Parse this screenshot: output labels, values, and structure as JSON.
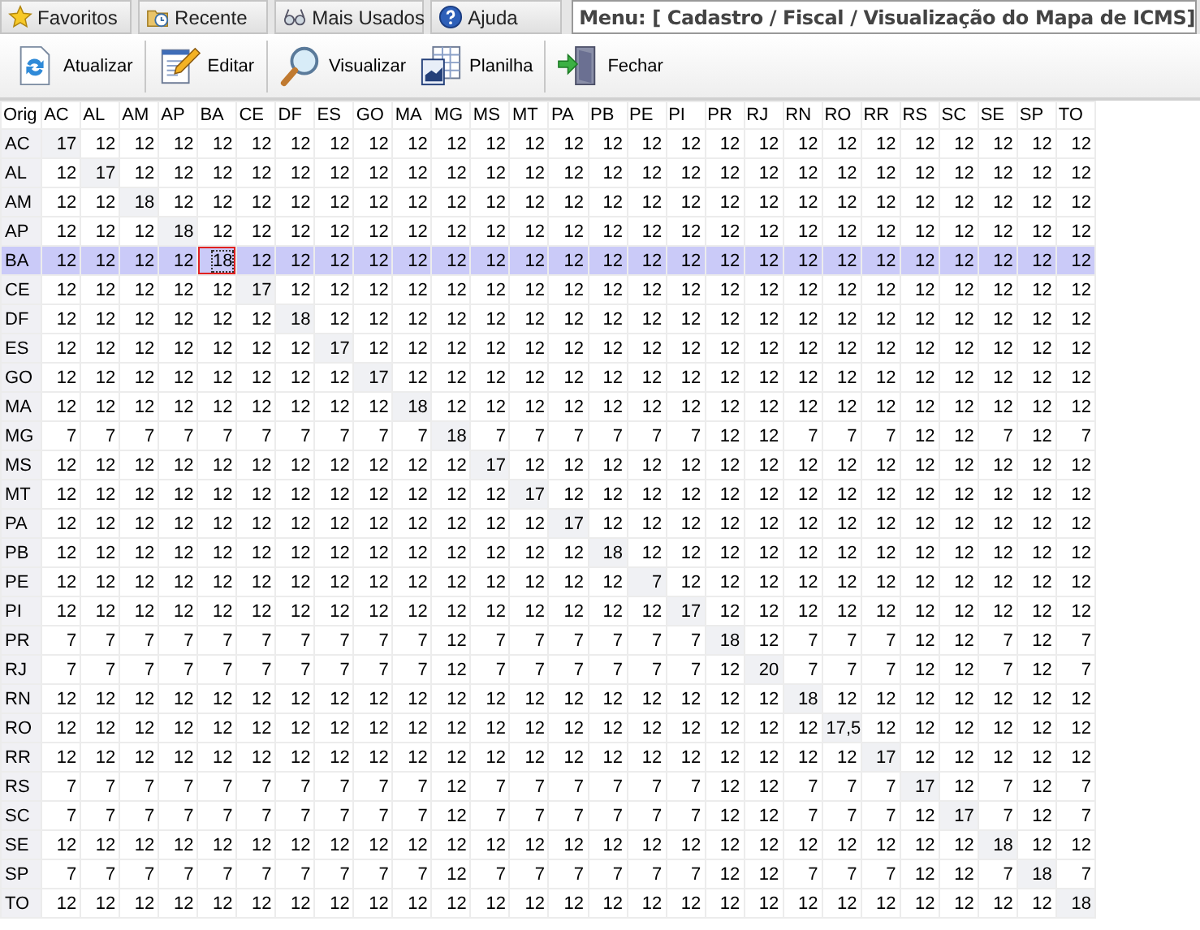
{
  "nav_tabs": [
    {
      "label": "Favoritos"
    },
    {
      "label": "Recente"
    },
    {
      "label": "Mais Usados"
    },
    {
      "label": "Ajuda"
    }
  ],
  "menu_path": "Menu: [ Cadastro / Fiscal / Visualização do Mapa de ICMS]",
  "toolbar": [
    {
      "label": "Atualizar",
      "separator_after": true
    },
    {
      "label": "Editar",
      "separator_after": true
    },
    {
      "label": "Visualizar",
      "separator_after": false
    },
    {
      "label": "Planilha",
      "separator_after": true
    },
    {
      "label": "Fechar",
      "separator_after": false
    }
  ],
  "table": {
    "corner": "Orig",
    "columns": [
      "AC",
      "AL",
      "AM",
      "AP",
      "BA",
      "CE",
      "DF",
      "ES",
      "GO",
      "MA",
      "MG",
      "MS",
      "MT",
      "PA",
      "PB",
      "PE",
      "PI",
      "PR",
      "RJ",
      "RN",
      "RO",
      "RR",
      "RS",
      "SC",
      "SE",
      "SP",
      "TO"
    ],
    "rows": [
      {
        "state": "AC",
        "selected": false,
        "cells": [
          "17",
          "12",
          "12",
          "12",
          "12",
          "12",
          "12",
          "12",
          "12",
          "12",
          "12",
          "12",
          "12",
          "12",
          "12",
          "12",
          "12",
          "12",
          "12",
          "12",
          "12",
          "12",
          "12",
          "12",
          "12",
          "12",
          "12"
        ]
      },
      {
        "state": "AL",
        "selected": false,
        "cells": [
          "12",
          "17",
          "12",
          "12",
          "12",
          "12",
          "12",
          "12",
          "12",
          "12",
          "12",
          "12",
          "12",
          "12",
          "12",
          "12",
          "12",
          "12",
          "12",
          "12",
          "12",
          "12",
          "12",
          "12",
          "12",
          "12",
          "12"
        ]
      },
      {
        "state": "AM",
        "selected": false,
        "cells": [
          "12",
          "12",
          "18",
          "12",
          "12",
          "12",
          "12",
          "12",
          "12",
          "12",
          "12",
          "12",
          "12",
          "12",
          "12",
          "12",
          "12",
          "12",
          "12",
          "12",
          "12",
          "12",
          "12",
          "12",
          "12",
          "12",
          "12"
        ]
      },
      {
        "state": "AP",
        "selected": false,
        "cells": [
          "12",
          "12",
          "12",
          "18",
          "12",
          "12",
          "12",
          "12",
          "12",
          "12",
          "12",
          "12",
          "12",
          "12",
          "12",
          "12",
          "12",
          "12",
          "12",
          "12",
          "12",
          "12",
          "12",
          "12",
          "12",
          "12",
          "12"
        ]
      },
      {
        "state": "BA",
        "selected": true,
        "cells": [
          "12",
          "12",
          "12",
          "12",
          {
            "value": "18",
            "focused": true
          },
          "12",
          "12",
          "12",
          "12",
          "12",
          "12",
          "12",
          "12",
          "12",
          "12",
          "12",
          "12",
          "12",
          "12",
          "12",
          "12",
          "12",
          "12",
          "12",
          "12",
          "12",
          "12"
        ]
      },
      {
        "state": "CE",
        "selected": false,
        "cells": [
          "12",
          "12",
          "12",
          "12",
          "12",
          "17",
          "12",
          "12",
          "12",
          "12",
          "12",
          "12",
          "12",
          "12",
          "12",
          "12",
          "12",
          "12",
          "12",
          "12",
          "12",
          "12",
          "12",
          "12",
          "12",
          "12",
          "12"
        ]
      },
      {
        "state": "DF",
        "selected": false,
        "cells": [
          "12",
          "12",
          "12",
          "12",
          "12",
          "12",
          "18",
          "12",
          "12",
          "12",
          "12",
          "12",
          "12",
          "12",
          "12",
          "12",
          "12",
          "12",
          "12",
          "12",
          "12",
          "12",
          "12",
          "12",
          "12",
          "12",
          "12"
        ]
      },
      {
        "state": "ES",
        "selected": false,
        "cells": [
          "12",
          "12",
          "12",
          "12",
          "12",
          "12",
          "12",
          "17",
          "12",
          "12",
          "12",
          "12",
          "12",
          "12",
          "12",
          "12",
          "12",
          "12",
          "12",
          "12",
          "12",
          "12",
          "12",
          "12",
          "12",
          "12",
          "12"
        ]
      },
      {
        "state": "GO",
        "selected": false,
        "cells": [
          "12",
          "12",
          "12",
          "12",
          "12",
          "12",
          "12",
          "12",
          "17",
          "12",
          "12",
          "12",
          "12",
          "12",
          "12",
          "12",
          "12",
          "12",
          "12",
          "12",
          "12",
          "12",
          "12",
          "12",
          "12",
          "12",
          "12"
        ]
      },
      {
        "state": "MA",
        "selected": false,
        "cells": [
          "12",
          "12",
          "12",
          "12",
          "12",
          "12",
          "12",
          "12",
          "12",
          "18",
          "12",
          "12",
          "12",
          "12",
          "12",
          "12",
          "12",
          "12",
          "12",
          "12",
          "12",
          "12",
          "12",
          "12",
          "12",
          "12",
          "12"
        ]
      },
      {
        "state": "MG",
        "selected": false,
        "cells": [
          "7",
          "7",
          "7",
          "7",
          "7",
          "7",
          "7",
          "7",
          "7",
          "7",
          "18",
          "7",
          "7",
          "7",
          "7",
          "7",
          "7",
          "12",
          "12",
          "7",
          "7",
          "7",
          "12",
          "12",
          "7",
          "12",
          "7"
        ]
      },
      {
        "state": "MS",
        "selected": false,
        "cells": [
          "12",
          "12",
          "12",
          "12",
          "12",
          "12",
          "12",
          "12",
          "12",
          "12",
          "12",
          "17",
          "12",
          "12",
          "12",
          "12",
          "12",
          "12",
          "12",
          "12",
          "12",
          "12",
          "12",
          "12",
          "12",
          "12",
          "12"
        ]
      },
      {
        "state": "MT",
        "selected": false,
        "cells": [
          "12",
          "12",
          "12",
          "12",
          "12",
          "12",
          "12",
          "12",
          "12",
          "12",
          "12",
          "12",
          "17",
          "12",
          "12",
          "12",
          "12",
          "12",
          "12",
          "12",
          "12",
          "12",
          "12",
          "12",
          "12",
          "12",
          "12"
        ]
      },
      {
        "state": "PA",
        "selected": false,
        "cells": [
          "12",
          "12",
          "12",
          "12",
          "12",
          "12",
          "12",
          "12",
          "12",
          "12",
          "12",
          "12",
          "12",
          "17",
          "12",
          "12",
          "12",
          "12",
          "12",
          "12",
          "12",
          "12",
          "12",
          "12",
          "12",
          "12",
          "12"
        ]
      },
      {
        "state": "PB",
        "selected": false,
        "cells": [
          "12",
          "12",
          "12",
          "12",
          "12",
          "12",
          "12",
          "12",
          "12",
          "12",
          "12",
          "12",
          "12",
          "12",
          "18",
          "12",
          "12",
          "12",
          "12",
          "12",
          "12",
          "12",
          "12",
          "12",
          "12",
          "12",
          "12"
        ]
      },
      {
        "state": "PE",
        "selected": false,
        "cells": [
          "12",
          "12",
          "12",
          "12",
          "12",
          "12",
          "12",
          "12",
          "12",
          "12",
          "12",
          "12",
          "12",
          "12",
          "12",
          "7",
          "12",
          "12",
          "12",
          "12",
          "12",
          "12",
          "12",
          "12",
          "12",
          "12",
          "12"
        ]
      },
      {
        "state": "PI",
        "selected": false,
        "cells": [
          "12",
          "12",
          "12",
          "12",
          "12",
          "12",
          "12",
          "12",
          "12",
          "12",
          "12",
          "12",
          "12",
          "12",
          "12",
          "12",
          "17",
          "12",
          "12",
          "12",
          "12",
          "12",
          "12",
          "12",
          "12",
          "12",
          "12"
        ]
      },
      {
        "state": "PR",
        "selected": false,
        "cells": [
          "7",
          "7",
          "7",
          "7",
          "7",
          "7",
          "7",
          "7",
          "7",
          "7",
          "12",
          "7",
          "7",
          "7",
          "7",
          "7",
          "7",
          "18",
          "12",
          "7",
          "7",
          "7",
          "12",
          "12",
          "7",
          "12",
          "7"
        ]
      },
      {
        "state": "RJ",
        "selected": false,
        "cells": [
          "7",
          "7",
          "7",
          "7",
          "7",
          "7",
          "7",
          "7",
          "7",
          "7",
          "12",
          "7",
          "7",
          "7",
          "7",
          "7",
          "7",
          "12",
          "20",
          "7",
          "7",
          "7",
          "12",
          "12",
          "7",
          "12",
          "7"
        ]
      },
      {
        "state": "RN",
        "selected": false,
        "cells": [
          "12",
          "12",
          "12",
          "12",
          "12",
          "12",
          "12",
          "12",
          "12",
          "12",
          "12",
          "12",
          "12",
          "12",
          "12",
          "12",
          "12",
          "12",
          "12",
          "18",
          "12",
          "12",
          "12",
          "12",
          "12",
          "12",
          "12"
        ]
      },
      {
        "state": "RO",
        "selected": false,
        "cells": [
          "12",
          "12",
          "12",
          "12",
          "12",
          "12",
          "12",
          "12",
          "12",
          "12",
          "12",
          "12",
          "12",
          "12",
          "12",
          "12",
          "12",
          "12",
          "12",
          "12",
          "17,5",
          "12",
          "12",
          "12",
          "12",
          "12",
          "12"
        ]
      },
      {
        "state": "RR",
        "selected": false,
        "cells": [
          "12",
          "12",
          "12",
          "12",
          "12",
          "12",
          "12",
          "12",
          "12",
          "12",
          "12",
          "12",
          "12",
          "12",
          "12",
          "12",
          "12",
          "12",
          "12",
          "12",
          "12",
          "17",
          "12",
          "12",
          "12",
          "12",
          "12"
        ]
      },
      {
        "state": "RS",
        "selected": false,
        "cells": [
          "7",
          "7",
          "7",
          "7",
          "7",
          "7",
          "7",
          "7",
          "7",
          "7",
          "12",
          "7",
          "7",
          "7",
          "7",
          "7",
          "7",
          "12",
          "12",
          "7",
          "7",
          "7",
          "17",
          "12",
          "7",
          "12",
          "7"
        ]
      },
      {
        "state": "SC",
        "selected": false,
        "cells": [
          "7",
          "7",
          "7",
          "7",
          "7",
          "7",
          "7",
          "7",
          "7",
          "7",
          "12",
          "7",
          "7",
          "7",
          "7",
          "7",
          "7",
          "12",
          "12",
          "7",
          "7",
          "7",
          "12",
          "17",
          "7",
          "12",
          "7"
        ]
      },
      {
        "state": "SE",
        "selected": false,
        "cells": [
          "12",
          "12",
          "12",
          "12",
          "12",
          "12",
          "12",
          "12",
          "12",
          "12",
          "12",
          "12",
          "12",
          "12",
          "12",
          "12",
          "12",
          "12",
          "12",
          "12",
          "12",
          "12",
          "12",
          "12",
          "18",
          "12",
          "12"
        ]
      },
      {
        "state": "SP",
        "selected": false,
        "cells": [
          "7",
          "7",
          "7",
          "7",
          "7",
          "7",
          "7",
          "7",
          "7",
          "7",
          "12",
          "7",
          "7",
          "7",
          "7",
          "7",
          "7",
          "12",
          "12",
          "7",
          "7",
          "7",
          "12",
          "12",
          "7",
          "18",
          "7"
        ]
      },
      {
        "state": "TO",
        "selected": false,
        "cells": [
          "12",
          "12",
          "12",
          "12",
          "12",
          "12",
          "12",
          "12",
          "12",
          "12",
          "12",
          "12",
          "12",
          "12",
          "12",
          "12",
          "12",
          "12",
          "12",
          "12",
          "12",
          "12",
          "12",
          "12",
          "12",
          "12",
          "18"
        ]
      }
    ]
  }
}
